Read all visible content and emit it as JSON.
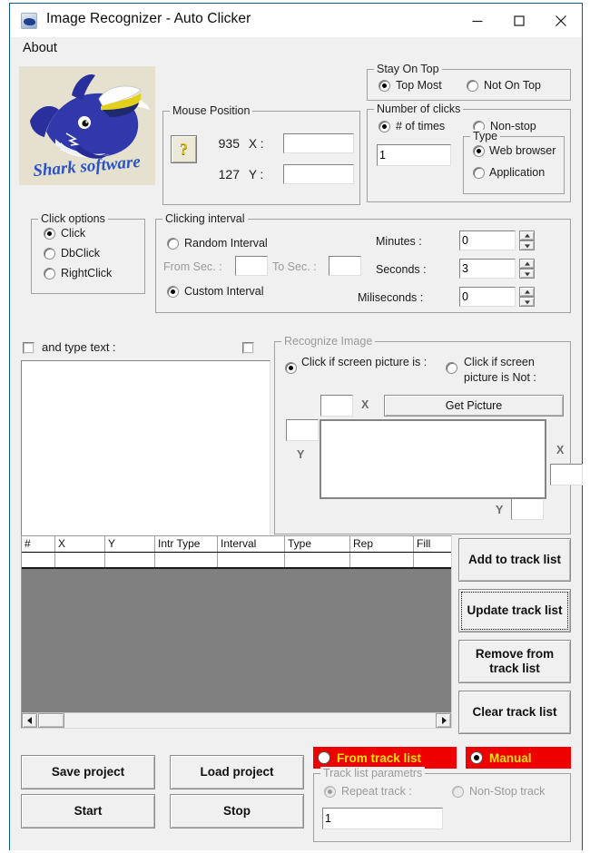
{
  "window": {
    "title": "Image Recognizer - Auto Clicker",
    "icon": "shark-app-icon",
    "minimize": "minimize-icon",
    "maximize": "maximize-icon",
    "close": "close-icon"
  },
  "menu": {
    "about": "About"
  },
  "logo": {
    "alt": "shark-software-logo",
    "wordmark": "Shark software",
    "background_color": "#e6e1cf",
    "shark_color": "#2a2f9e"
  },
  "mouse_position": {
    "title": "Mouse Position",
    "help_button": "?",
    "x_value": "935",
    "x_label": "X :",
    "x_field": "",
    "y_value": "127",
    "y_label": "Y :",
    "y_field": ""
  },
  "stay_on_top": {
    "title": "Stay On Top",
    "options": [
      {
        "label": "Top Most",
        "selected": true
      },
      {
        "label": "Not On Top",
        "selected": false
      }
    ]
  },
  "number_of_clicks": {
    "title": "Number of clicks",
    "options": [
      {
        "label": "# of times",
        "selected": true
      },
      {
        "label": "Non-stop",
        "selected": false
      }
    ],
    "count_value": "1",
    "type": {
      "title": "Type",
      "options": [
        {
          "label": "Web browser",
          "selected": true
        },
        {
          "label": "Application",
          "selected": false
        }
      ]
    }
  },
  "click_options": {
    "title": "Click options",
    "options": [
      {
        "label": "Click",
        "selected": true
      },
      {
        "label": "DbClick",
        "selected": false
      },
      {
        "label": "RightClick",
        "selected": false
      }
    ]
  },
  "clicking_interval": {
    "title": "Clicking interval",
    "random_label": "Random Interval",
    "random_selected": false,
    "from_sec_label": "From Sec. :",
    "from_sec_value": "",
    "to_sec_label": "To Sec. :",
    "to_sec_value": "",
    "custom_label": "Custom Interval",
    "custom_selected": true,
    "minutes_label": "Minutes :",
    "minutes_value": "0",
    "seconds_label": "Seconds :",
    "seconds_value": "3",
    "miliseconds_label": "Miliseconds :",
    "miliseconds_value": "0"
  },
  "type_text": {
    "checkbox_label": "and type text :",
    "checked": false,
    "second_checkbox_checked": false,
    "text_value": ""
  },
  "recognize_image": {
    "title": "Recognize Image",
    "enabled": false,
    "option_is_label": "Click if screen picture is :",
    "option_is_selected": true,
    "option_not_label": "Click if screen picture is Not :",
    "option_not_selected": false,
    "top_x_value": "",
    "top_x_label": "X",
    "get_picture_label": "Get Picture",
    "left_y_value": "",
    "left_y_label": "Y",
    "right_x_value": "",
    "right_x_label": "X",
    "bottom_y_value": "",
    "bottom_y_label": "Y"
  },
  "track_grid": {
    "columns": [
      "#",
      "X",
      "Y",
      "Intr Type",
      "Interval",
      "Type",
      "Rep",
      "Fill"
    ],
    "rows": [],
    "body_color": "#808080",
    "scroll_left_icon": "triangle-left-icon",
    "scroll_right_icon": "triangle-right-icon"
  },
  "track_buttons": {
    "add": "Add to track list",
    "update": "Update track list",
    "remove": "Remove from track list",
    "clear": "Clear track list",
    "focused": "update"
  },
  "project_buttons": {
    "save": "Save project",
    "load": "Load project",
    "start": "Start",
    "stop": "Stop"
  },
  "mode": {
    "from_track_list": "From track list",
    "from_track_list_selected": false,
    "manual": "Manual",
    "manual_selected": true,
    "accent_color": "#ef0000",
    "accent_text_color": "#ffe000"
  },
  "track_list_params": {
    "title": "Track list parametrs",
    "enabled": false,
    "repeat_label": "Repeat track :",
    "repeat_selected": true,
    "nonstop_label": "Non-Stop track",
    "nonstop_selected": false,
    "repeat_value": "1"
  }
}
